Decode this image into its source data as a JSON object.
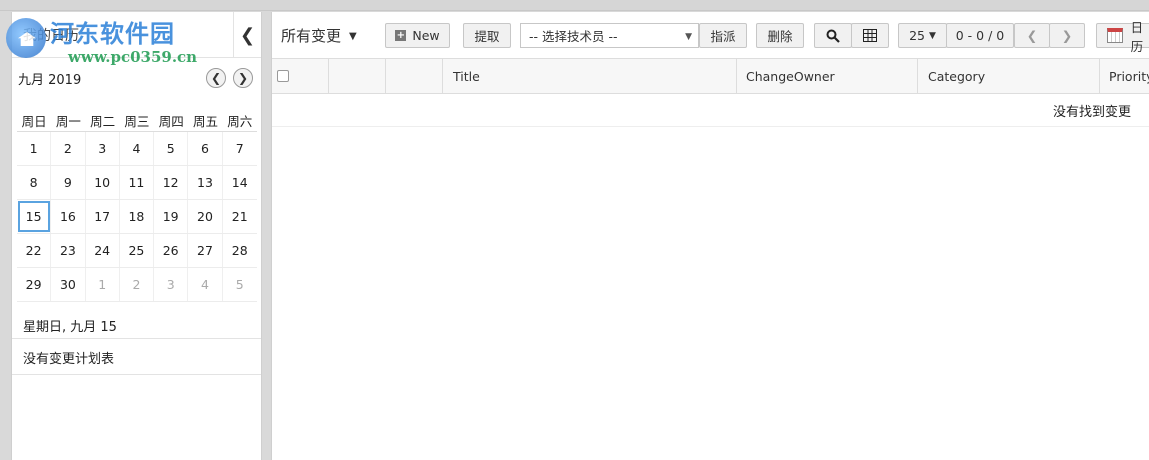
{
  "left_panel": {
    "title": "我的日历",
    "collapse_icon": "chevron-left-icon",
    "watermark": {
      "text": "河东软件园",
      "url": "www.pc0359.cn"
    },
    "calendar": {
      "month_label": "九月 2019",
      "prev_icon": "chevron-left-icon",
      "next_icon": "chevron-right-icon",
      "weekdays": [
        "周日",
        "周一",
        "周二",
        "周三",
        "周四",
        "周五",
        "周六"
      ],
      "weeks": [
        [
          "1",
          "2",
          "3",
          "4",
          "5",
          "6",
          "7"
        ],
        [
          "8",
          "9",
          "10",
          "11",
          "12",
          "13",
          "14"
        ],
        [
          "15",
          "16",
          "17",
          "18",
          "19",
          "20",
          "21"
        ],
        [
          "22",
          "23",
          "24",
          "25",
          "26",
          "27",
          "28"
        ],
        [
          "29",
          "30",
          "1",
          "2",
          "3",
          "4",
          "5"
        ]
      ],
      "today": "15"
    },
    "selected_date": "星期日, 九月 15",
    "no_plan_text": "没有变更计划表"
  },
  "toolbar": {
    "view_label": "所有变更",
    "new_label": "New",
    "pick_label": "提取",
    "tech_placeholder": "-- 选择技术员 --",
    "assign_label": "指派",
    "delete_label": "删除",
    "search_icon": "search-icon",
    "columns_icon": "grid-icon",
    "per_page": "25",
    "range": "0 - 0 / 0",
    "date_label": "日历"
  },
  "table": {
    "headers": [
      "",
      "",
      "",
      "Title",
      "ChangeOwner",
      "Category",
      "Priority"
    ],
    "empty_message": "没有找到变更"
  },
  "colors": {
    "accent": "#5aa3e0",
    "watermark_blue": "#2a7fd8",
    "watermark_green": "#2aa05a"
  }
}
